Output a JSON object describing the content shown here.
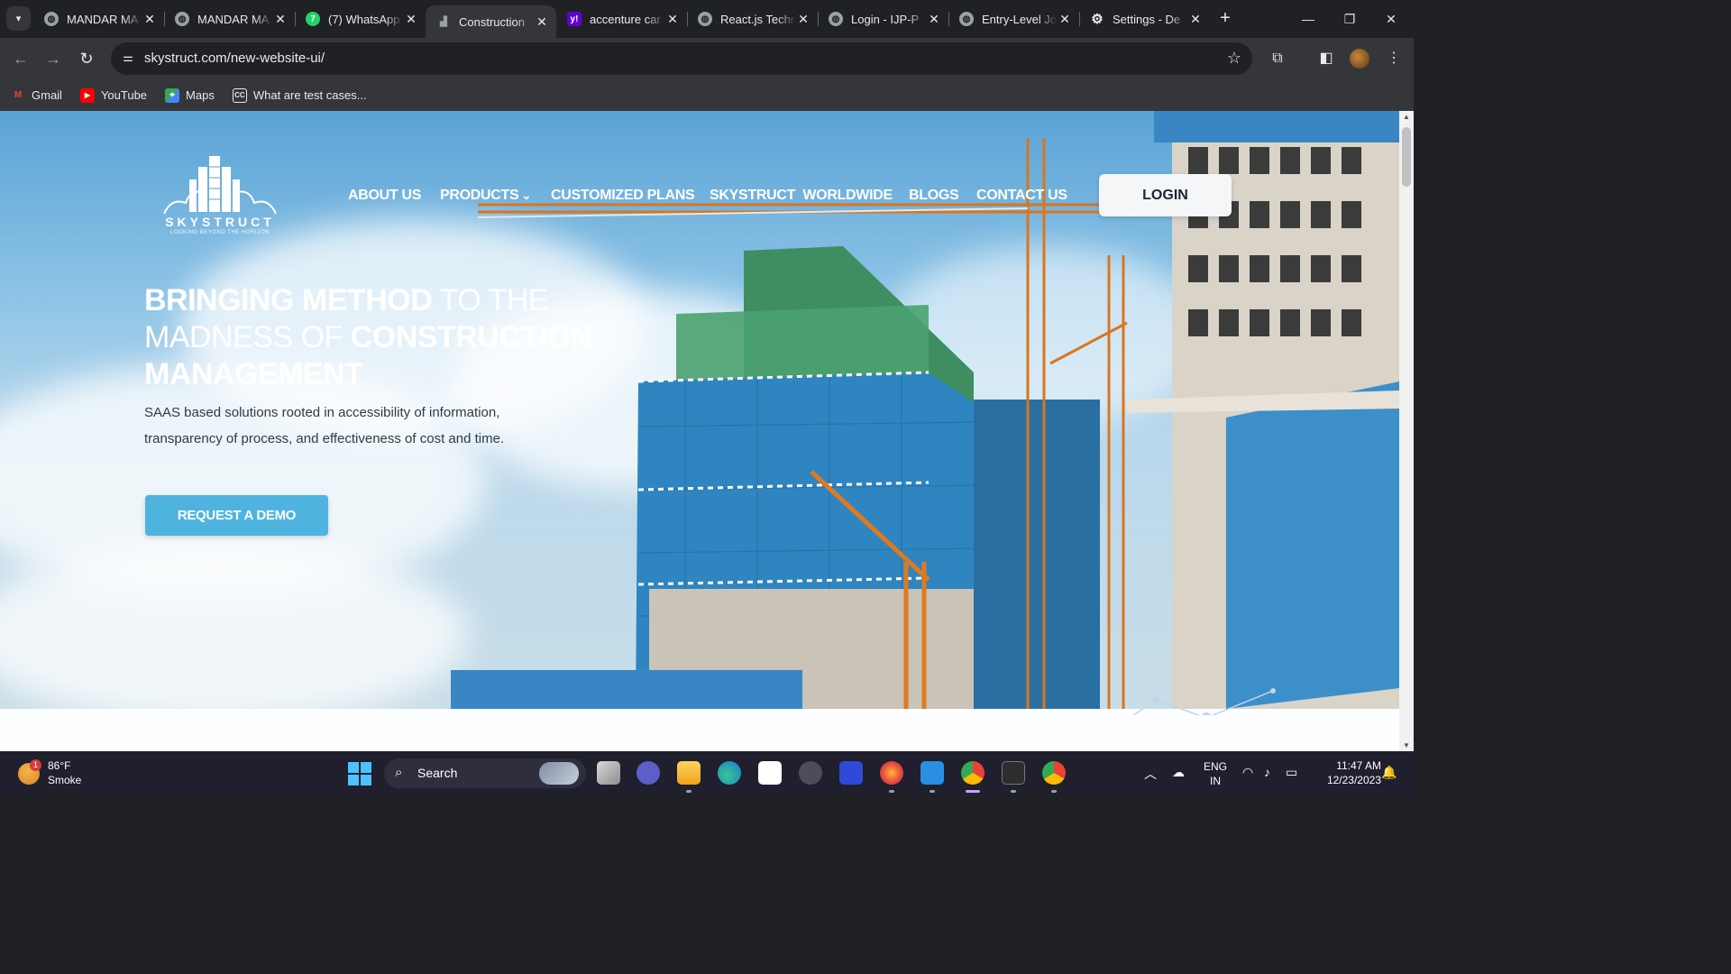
{
  "browser": {
    "tabs": [
      {
        "title": "MANDAR MA",
        "icon": "globe-icon"
      },
      {
        "title": "MANDAR MA",
        "icon": "globe-icon"
      },
      {
        "title": "(7) WhatsApp",
        "icon": "whatsapp-icon"
      },
      {
        "title": "Construction",
        "icon": "skystruct-favicon",
        "active": true
      },
      {
        "title": "accenture car",
        "icon": "yahoo-icon"
      },
      {
        "title": "React.js Techr",
        "icon": "globe-icon"
      },
      {
        "title": "Login - IJP-P",
        "icon": "globe-icon"
      },
      {
        "title": "Entry-Level Jo",
        "icon": "globe-icon"
      },
      {
        "title": "Settings - De",
        "icon": "gear-icon"
      }
    ],
    "url": "skystruct.com/new-website-ui/",
    "bookmarks": [
      {
        "label": "Gmail",
        "icon": "gmail-icon"
      },
      {
        "label": "YouTube",
        "icon": "youtube-icon"
      },
      {
        "label": "Maps",
        "icon": "maps-icon"
      },
      {
        "label": "What are test cases...",
        "icon": "cc-icon"
      }
    ]
  },
  "site": {
    "logo_name": "SKYSTRUCT",
    "logo_tagline": "LOOKING BEYOND THE HORIZON",
    "nav": {
      "about": "ABOUT US",
      "products": "PRODUCTS",
      "plans": "CUSTOMIZED PLANS",
      "worldwide": "SKYSTRUCT  WORLDWIDE",
      "blogs": "BLOGS",
      "contact": "CONTACT US"
    },
    "login_label": "LOGIN",
    "headline": {
      "part1": "BRINGING METHOD",
      "part2": " TO THE MADNESS OF ",
      "part3": "CONSTRUCTION MANAGEMENT"
    },
    "subtext": "SAAS based solutions rooted in accessibility of information, transparency of process, and effectiveness of cost and time.",
    "cta_label": "REQUEST A DEMO",
    "colors": {
      "cta": "#4fb3e0",
      "login_bg": "#f4f6f7"
    }
  },
  "taskbar": {
    "weather_temp": "86°F",
    "weather_desc": "Smoke",
    "weather_badge": "1",
    "search_label": "Search",
    "lang_top": "ENG",
    "lang_bottom": "IN",
    "time": "11:47 AM",
    "date": "12/23/2023"
  }
}
